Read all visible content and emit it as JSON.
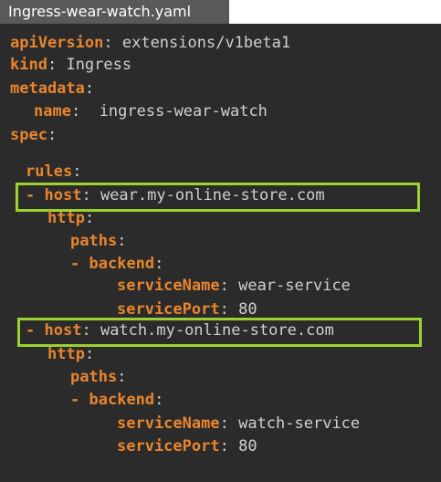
{
  "file_tab": {
    "label": "Ingress-wear-watch.yaml"
  },
  "yaml": {
    "apiVersion_key": "apiVersion",
    "apiVersion_value": "extensions/v1beta1",
    "kind_key": "kind",
    "kind_value": "Ingress",
    "metadata_key": "metadata",
    "name_key": "name",
    "name_value": "ingress-wear-watch",
    "spec_key": "spec",
    "rules_key": "rules",
    "rules": [
      {
        "dash": "-",
        "host_key": "host",
        "host_value": "wear.my-online-store.com",
        "http_key": "http",
        "paths_key": "paths",
        "backend_dash": "-",
        "backend_key": "backend",
        "serviceName_key": "serviceName",
        "serviceName_value": "wear-service",
        "servicePort_key": "servicePort",
        "servicePort_value": "80"
      },
      {
        "dash": "-",
        "host_key": "host",
        "host_value": "watch.my-online-store.com",
        "http_key": "http",
        "paths_key": "paths",
        "backend_dash": "-",
        "backend_key": "backend",
        "serviceName_key": "serviceName",
        "serviceName_value": "watch-service",
        "servicePort_key": "servicePort",
        "servicePort_value": "80"
      }
    ],
    "colon": ":"
  },
  "colors": {
    "editor_background": "#2b2b2b",
    "key": "#e8852e",
    "value": "#d0d0d0",
    "highlight_box": "#9cd12f",
    "tab_background": "#595959"
  }
}
